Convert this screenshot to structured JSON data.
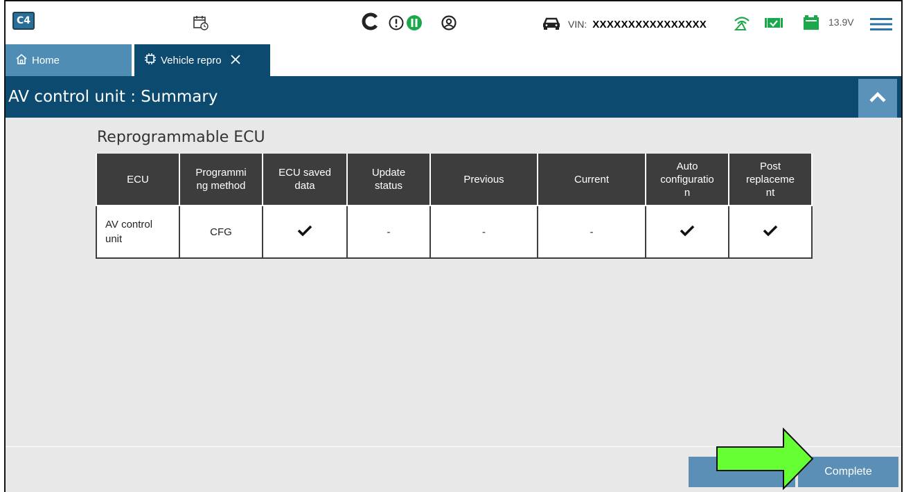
{
  "topbar": {
    "logo_text": "C4",
    "icons": [
      "calendar-clock-icon",
      "refresh-icon",
      "alert-icon",
      "pause-icon",
      "user-icon",
      "car-icon",
      "wifi-icon",
      "vci-icon",
      "battery-icon",
      "menu-icon"
    ],
    "vin_label": "VIN:",
    "vin_value": "XXXXXXXXXXXXXXXX",
    "voltage": "13.9V"
  },
  "tabs": [
    {
      "label": "Home",
      "icon": "home-icon",
      "active": false
    },
    {
      "label": "Vehicle repro",
      "icon": "chip-icon",
      "active": true
    }
  ],
  "header": {
    "title": "AV control unit : Summary"
  },
  "section": {
    "title": "Reprogrammable ECU"
  },
  "table": {
    "columns": [
      "ECU",
      "Programmi\nng method",
      "ECU saved\ndata",
      "Update\nstatus",
      "Previous",
      "Current",
      "Auto\nconfiguratio\nn",
      "Post\nreplaceme\nnt"
    ],
    "rows": [
      {
        "ecu": "AV control\nunit",
        "method": "CFG",
        "saved": "✔",
        "update": "-",
        "previous": "-",
        "current": "-",
        "auto_config": "✔",
        "post_replacement": "✔"
      }
    ]
  },
  "footer": {
    "complete_label": "Complete"
  },
  "colors": {
    "header_bg": "#0d4a6f",
    "tab_home_bg": "#4f8db5",
    "button_bg": "#5b8fb6",
    "arrow_fill": "#66ff33",
    "status_green": "#1aa84a"
  }
}
